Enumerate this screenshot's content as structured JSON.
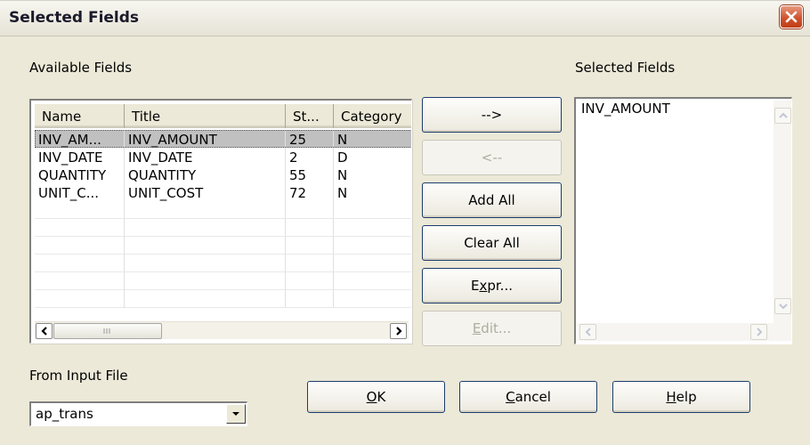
{
  "window": {
    "title": "Selected Fields"
  },
  "available": {
    "label": "Available Fields",
    "columns": [
      "Name",
      "Title",
      "St...",
      "Category"
    ],
    "rows": [
      [
        "INV_AM...",
        "INV_AMOUNT",
        "25",
        "N"
      ],
      [
        "INV_DATE",
        "INV_DATE",
        "2",
        "D"
      ],
      [
        "QUANTITY",
        "QUANTITY",
        "55",
        "N"
      ],
      [
        "UNIT_C...",
        "UNIT_COST",
        "72",
        "N"
      ]
    ],
    "selected_row": 0
  },
  "buttons": {
    "add": "-->",
    "remove": "<--",
    "add_all": "Add All",
    "clear_all": "Clear All",
    "expr_pre": "E",
    "expr_u": "x",
    "expr_post": "pr...",
    "edit_u": "E",
    "edit_post": "dit..."
  },
  "selected": {
    "label": "Selected Fields",
    "items": [
      "INV_AMOUNT"
    ]
  },
  "input_file": {
    "label": "From Input File",
    "value": "ap_trans"
  },
  "footer": {
    "ok_u": "O",
    "ok_post": "K",
    "cancel_u": "C",
    "cancel_post": "ancel",
    "help_u": "H",
    "help_post": "elp"
  }
}
